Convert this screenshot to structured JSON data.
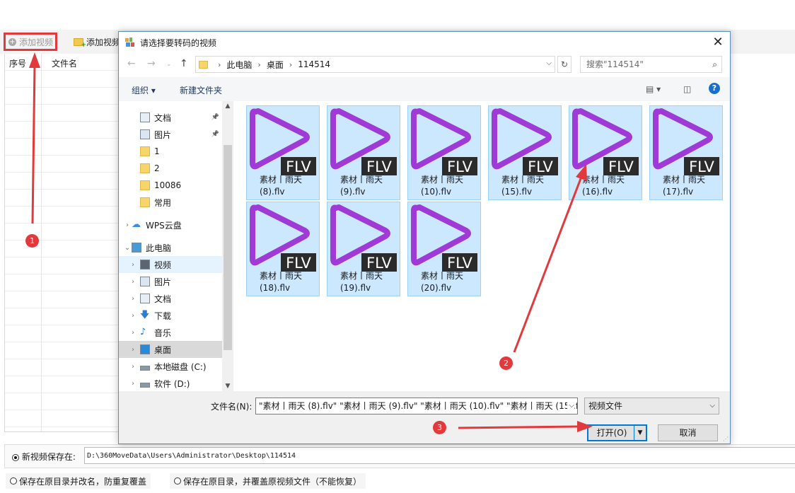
{
  "app": {
    "add_video_label": "添加视频",
    "add_folder_label": "添加视频",
    "columns": [
      "序号",
      "文件名"
    ],
    "save_radio_label": "新视频保存在:",
    "save_path": "D:\\360MoveData\\Users\\Administrator\\Desktop\\114514",
    "option1": "保存在原目录并改名，防重复覆盖",
    "option2": "保存在原目录，并覆盖原视频文件（不能恢复）"
  },
  "dialog": {
    "title": "请选择要转码的视频",
    "close": "✕",
    "breadcrumb": [
      "此电脑",
      "桌面",
      "114514"
    ],
    "search_placeholder": "搜索\"114514\"",
    "organize": "组织",
    "new_folder": "新建文件夹",
    "help": "?",
    "tree": [
      {
        "label": "文档",
        "icon": "document-icon",
        "pinned": true
      },
      {
        "label": "图片",
        "icon": "picture-icon",
        "pinned": true
      },
      {
        "label": "1",
        "icon": "folder-icon"
      },
      {
        "label": "2",
        "icon": "folder-icon"
      },
      {
        "label": "10086",
        "icon": "folder-icon"
      },
      {
        "label": "常用",
        "icon": "folder-icon"
      },
      {
        "label": "WPS云盘",
        "icon": "cloud-icon"
      },
      {
        "label": "此电脑",
        "icon": "computer-icon"
      },
      {
        "label": "视频",
        "icon": "video-icon"
      },
      {
        "label": "图片",
        "icon": "picture-icon"
      },
      {
        "label": "文档",
        "icon": "document-icon"
      },
      {
        "label": "下载",
        "icon": "download-icon"
      },
      {
        "label": "音乐",
        "icon": "music-icon"
      },
      {
        "label": "桌面",
        "icon": "desktop-icon"
      },
      {
        "label": "本地磁盘 (C:)",
        "icon": "drive-icon"
      },
      {
        "label": "软件 (D:)",
        "icon": "drive-icon"
      }
    ],
    "files": [
      {
        "line1": "素材丨雨天",
        "line2": "(8).flv"
      },
      {
        "line1": "素材丨雨天",
        "line2": "(9).flv"
      },
      {
        "line1": "素材丨雨天",
        "line2": "(10).flv"
      },
      {
        "line1": "素材丨雨天",
        "line2": "(15).flv"
      },
      {
        "line1": "素材丨雨天",
        "line2": "(16).flv"
      },
      {
        "line1": "素材丨雨天",
        "line2": "(17).flv"
      },
      {
        "line1": "素材丨雨天",
        "line2": "(18).flv"
      },
      {
        "line1": "素材丨雨天",
        "line2": "(19).flv"
      },
      {
        "line1": "素材丨雨天",
        "line2": "(20).flv"
      }
    ],
    "file_badge": "FLV",
    "filename_label": "文件名(N):",
    "filename_value": "\"素材丨雨天 (8).flv\" \"素材丨雨天 (9).flv\" \"素材丨雨天 (10).flv\" \"素材丨雨天 (15).f",
    "filetype_value": "视频文件",
    "open_label": "打开(O)",
    "cancel_label": "取消"
  },
  "annotations": {
    "badges": [
      "1",
      "2",
      "3"
    ],
    "color": "#e2393d"
  },
  "colors": {
    "accent": "#0078d7",
    "selection": "#cce8ff",
    "play_icon": "#a03ad6",
    "marker": "#e0393e"
  }
}
